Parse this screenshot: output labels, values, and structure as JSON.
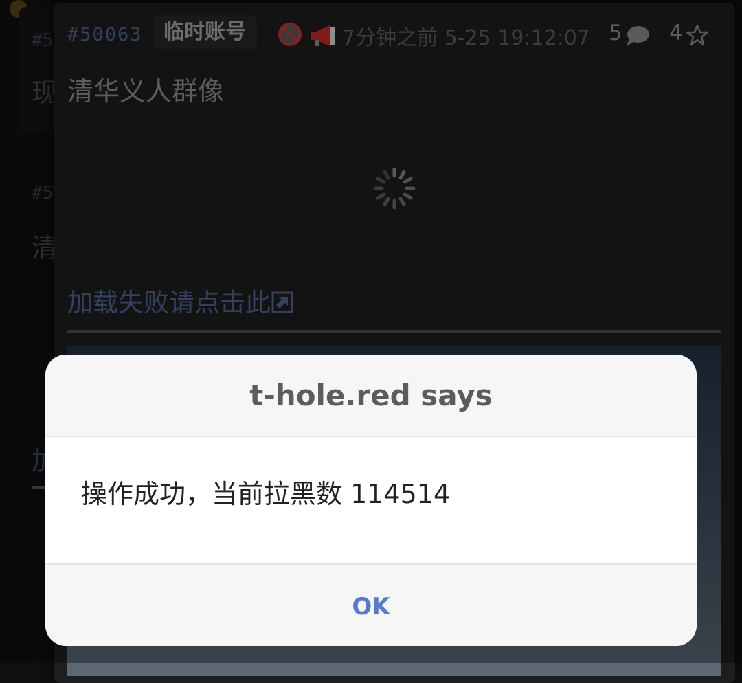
{
  "background_feed": {
    "pid_partial": "#5",
    "text_partial_1": "现",
    "text_partial_2": "清",
    "text_partial_3": "加"
  },
  "post": {
    "pid": "#50063",
    "badge": "临时账号",
    "time": "7分钟之前 5-25 19:12:07",
    "reply_count": "5",
    "like_count": "4",
    "text": "清华义人群像",
    "reload_link": "加载失败请点击此",
    "icons": [
      "no-entry-icon",
      "speaker-icon",
      "speech-bubble-icon",
      "star-icon",
      "external-link-icon",
      "loading-spinner-icon"
    ]
  },
  "dialog": {
    "title": "t-hole.red says",
    "message": "操作成功，当前拉黑数 114514",
    "ok_label": "OK"
  },
  "colors": {
    "accent_blue": "#5879cc",
    "pid_blue": "#4e6591",
    "no_entry_red": "#d0302f",
    "speaker_red": "#cc2a25"
  }
}
